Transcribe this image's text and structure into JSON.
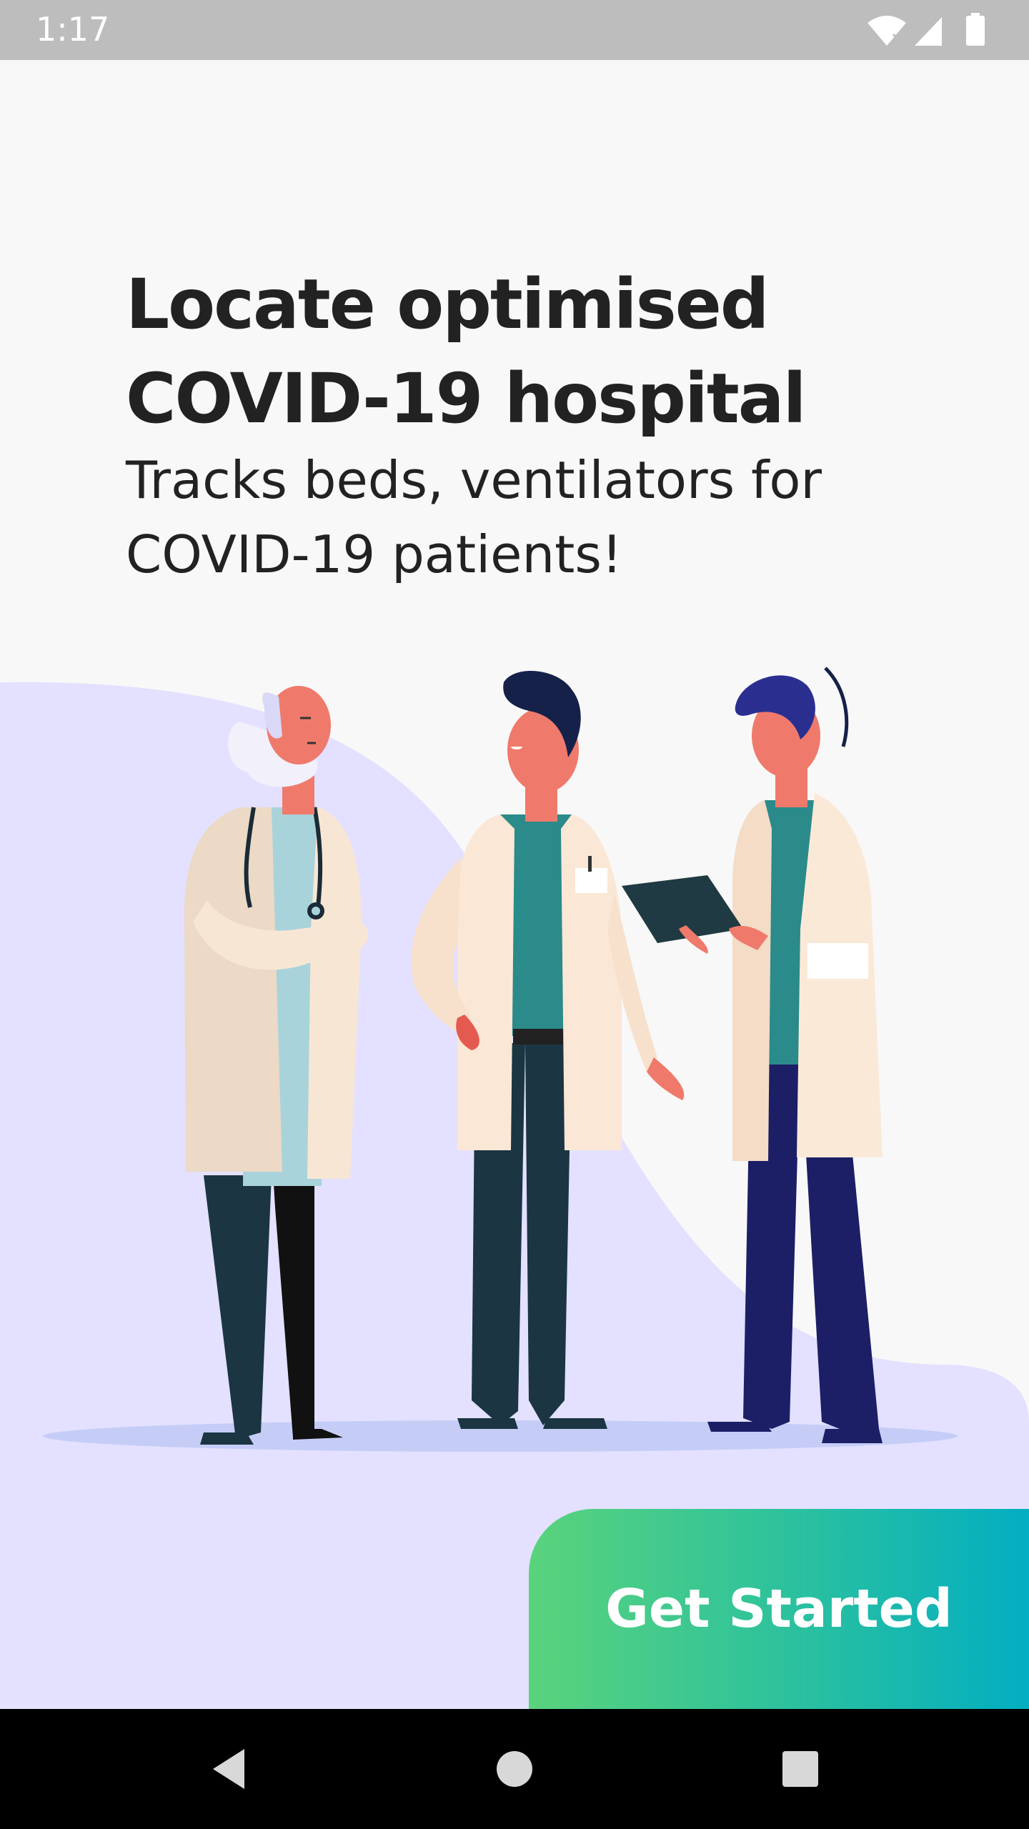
{
  "status_bar": {
    "time": "1:17",
    "icons": [
      "wifi-icon",
      "signal-icon",
      "battery-icon"
    ]
  },
  "onboarding": {
    "headline_line1": "Locate optimised",
    "headline_line2": "COVID-19 hospital",
    "subtitle_line1": "Tracks beds, ventilators for",
    "subtitle_line2": "COVID-19 patients!",
    "illustration": "three-doctors-illustration",
    "cta_label": "Get Started"
  },
  "nav_bar": {
    "buttons": [
      "back-icon",
      "home-icon",
      "recents-icon"
    ]
  },
  "colors": {
    "background": "#f8f8f8",
    "blob": "#e3e1ff",
    "status_bar": "#bdbdbd",
    "cta_gradient_start": "#5ad37c",
    "cta_gradient_end": "#03aec2",
    "text": "#222222"
  }
}
